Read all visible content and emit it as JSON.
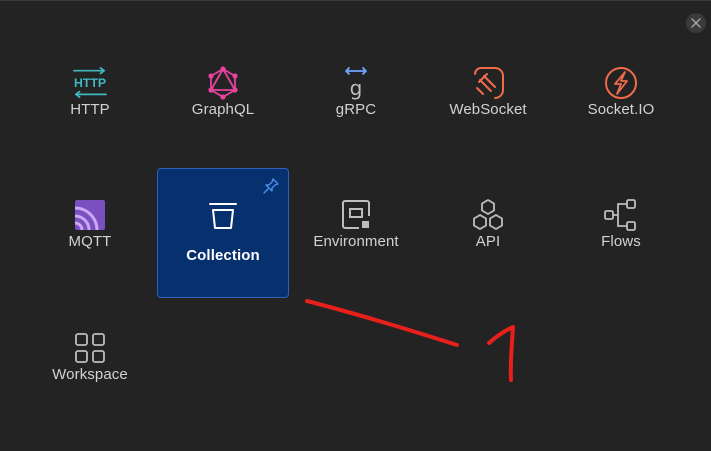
{
  "dialog": {
    "close_icon": "close-icon"
  },
  "tiles": [
    {
      "label": "HTTP",
      "icon": "http-icon",
      "color": "#3fb8c4"
    },
    {
      "label": "GraphQL",
      "icon": "graphql-icon",
      "color": "#e6429e"
    },
    {
      "label": "gRPC",
      "icon": "grpc-icon",
      "color": "#6ea8ff"
    },
    {
      "label": "WebSocket",
      "icon": "websocket-icon",
      "color": "#f06b4a"
    },
    {
      "label": "Socket.IO",
      "icon": "socketio-icon",
      "color": "#f06b4a"
    },
    {
      "label": "MQTT",
      "icon": "mqtt-icon",
      "color": "#9a6bd6"
    },
    {
      "label": "Collection",
      "icon": "collection-icon",
      "color": "#ffffff",
      "selected": true,
      "pinned": true
    },
    {
      "label": "Environment",
      "icon": "environment-icon",
      "color": "#bdbdbd"
    },
    {
      "label": "API",
      "icon": "api-icon",
      "color": "#bdbdbd"
    },
    {
      "label": "Flows",
      "icon": "flows-icon",
      "color": "#bdbdbd"
    },
    {
      "label": "Workspace",
      "icon": "workspace-icon",
      "color": "#bdbdbd"
    }
  ],
  "annotation": {
    "color": "#e8201c"
  }
}
